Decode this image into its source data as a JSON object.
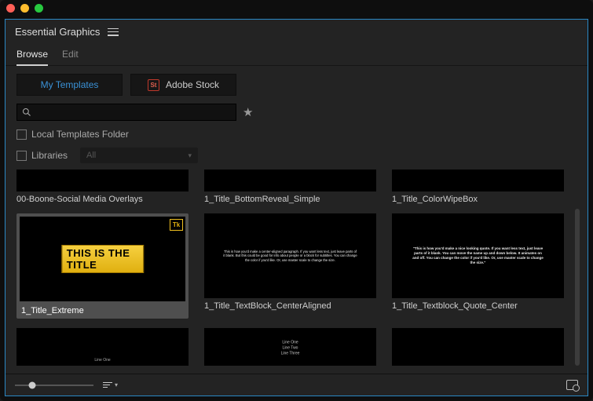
{
  "window": {
    "title": "Essential Graphics"
  },
  "tabs": {
    "browse": "Browse",
    "edit": "Edit",
    "active": "browse"
  },
  "sourceButtons": {
    "myTemplates": "My Templates",
    "adobeStock": "Adobe Stock",
    "stBadge": "St"
  },
  "search": {
    "value": ""
  },
  "filters": {
    "localFolder": {
      "label": "Local Templates Folder",
      "checked": false
    },
    "libraries": {
      "label": "Libraries",
      "checked": false,
      "dropdown": "All"
    }
  },
  "templates": {
    "row1": [
      {
        "name": "00-Boone-Social Media Overlays"
      },
      {
        "name": "1_Title_BottomReveal_Simple"
      },
      {
        "name": "1_Title_ColorWipeBox"
      }
    ],
    "row2": [
      {
        "name": "1_Title_Extreme",
        "selected": true,
        "preview": "extreme",
        "previewText": "THIS IS THE TITLE"
      },
      {
        "name": "1_Title_TextBlock_CenterAligned",
        "preview": "centerblock",
        "previewText": "This is how you'd make a center-aligned paragraph. If you want less text, just leave parts of it blank. But this could be good for info about people or a block for subtitles. You can change the color if you'd like. Or, use master scale to change the size."
      },
      {
        "name": "1_Title_Textblock_Quote_Center",
        "preview": "quote",
        "previewText": "\"This is how you'd make a nice looking quote. If you want less text, just leave parts of it blank. You can move the name up and down below. It animates on and off. You can change the color if you'd like. Or, use master scale to change the size.\""
      }
    ],
    "row3": [
      {
        "preview": "lineone",
        "previewText": "Line One"
      },
      {
        "preview": "lineslist",
        "previewLines": [
          "Line One",
          "Line Two",
          "Line Three"
        ]
      },
      {
        "preview": "blank"
      }
    ]
  },
  "footer": {}
}
